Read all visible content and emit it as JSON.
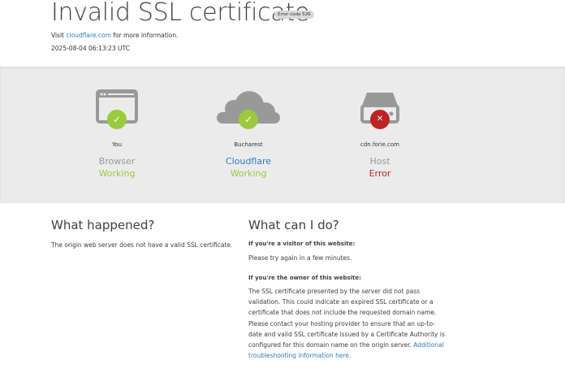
{
  "header": {
    "title": "Invalid SSL certificate",
    "error_code": "Error code 526",
    "visit_prefix": "Visit ",
    "visit_link": "cloudflare.com",
    "visit_suffix": " for more information.",
    "timestamp": "2025-08-04 06:13:23 UTC"
  },
  "status": [
    {
      "location": "You",
      "role": "Browser",
      "state": "Working",
      "icon": "browser-icon",
      "result": "check"
    },
    {
      "location": "Bucharest",
      "role": "Cloudflare",
      "state": "Working",
      "icon": "cloud-icon",
      "result": "check"
    },
    {
      "location": "cdn.forie.com",
      "role": "Host",
      "state": "Error",
      "icon": "server-icon",
      "result": "x"
    }
  ],
  "colors": {
    "ok": "#9bca3e",
    "error": "#bd2426",
    "link": "#2f7bbf",
    "icon_gray": "#999999"
  },
  "what_happened": {
    "heading": "What happened?",
    "body": "The origin web server does not have a valid SSL certificate."
  },
  "what_can_i_do": {
    "heading": "What can I do?",
    "visitor_label": "If you're a visitor of this website:",
    "visitor_body": "Please try again in a few minutes.",
    "owner_label": "If you're the owner of this website:",
    "owner_body": "The SSL certificate presented by the server did not pass validation. This could indicate an expired SSL certificate or a certificate that does not include the requested domain name. Please contact your hosting provider to ensure that an up-to-date and valid SSL certificate issued by a Certificate Authority is configured for this domain name on the origin server. ",
    "owner_link": "Additional troubleshooting information here."
  }
}
